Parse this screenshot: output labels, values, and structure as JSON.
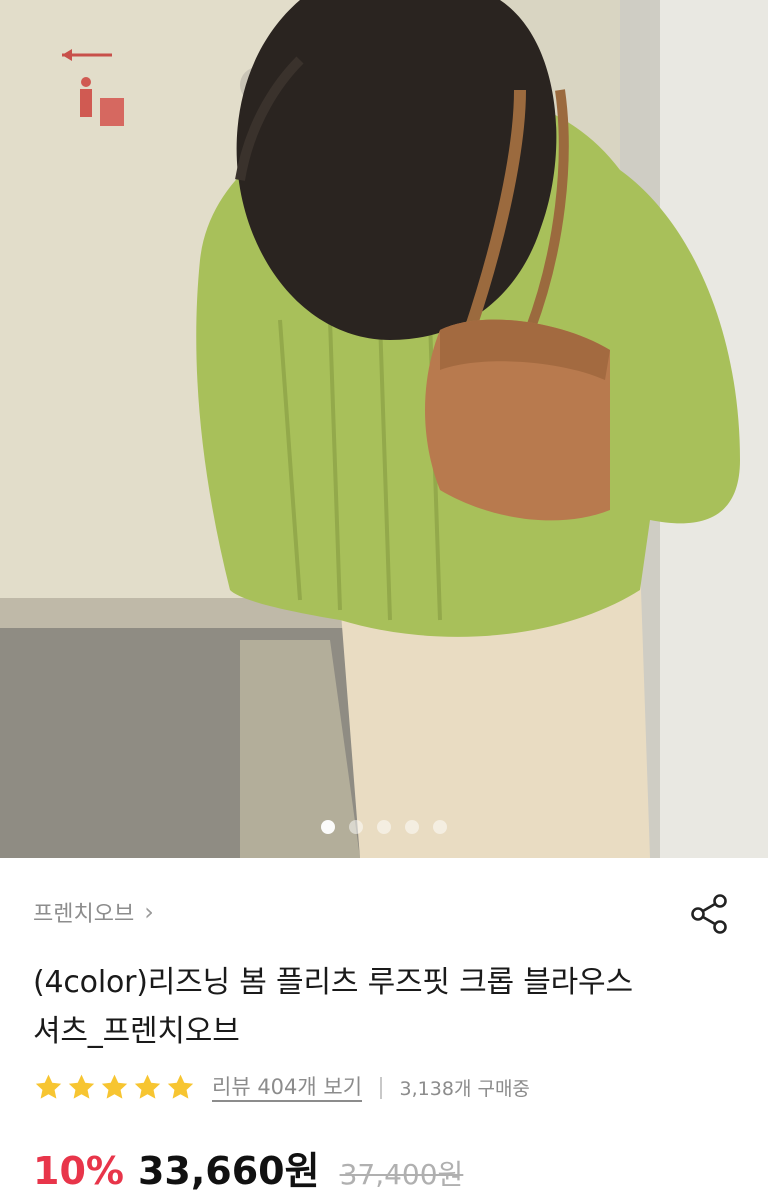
{
  "product": {
    "seller": "프렌치오브",
    "seller_chevron": "›",
    "title_line1": "(4color)리즈닝 봄 플리츠 루즈핏 크롭 블라우스",
    "title_line2": "셔츠_프렌치오브",
    "rating_stars": 5,
    "review_link": "리뷰 404개 보기",
    "buyers": "3,138개 구매중",
    "discount": "10%",
    "price": "33,660원",
    "original_price": "37,400원"
  },
  "carousel": {
    "count": 5,
    "active_index": 0
  },
  "colors": {
    "accent_red": "#e8354a",
    "star_yellow": "#f7c531"
  },
  "icons": {
    "share": "share-icon",
    "star": "star-icon",
    "chevron": "chevron-right-icon"
  }
}
